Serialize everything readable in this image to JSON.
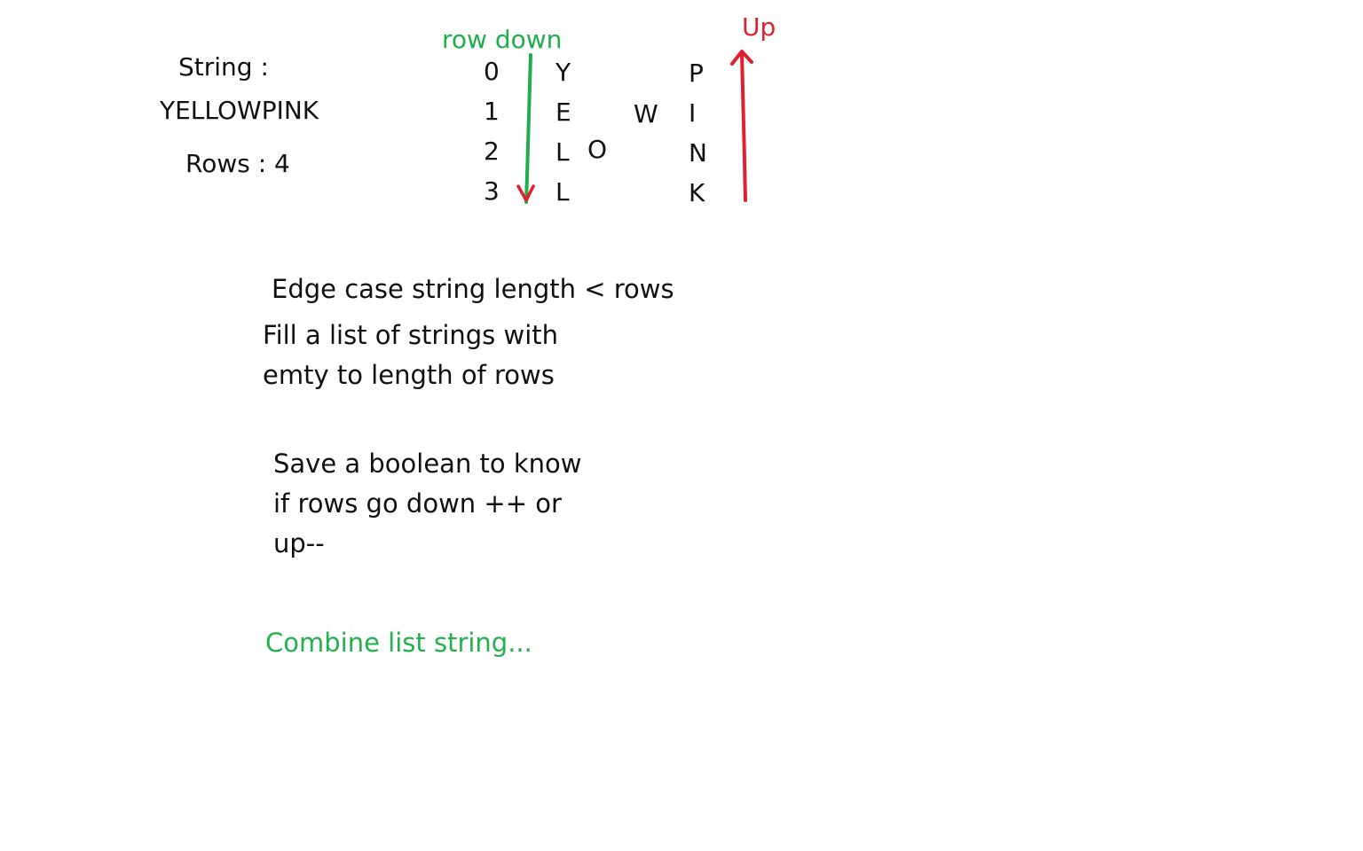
{
  "string_label": "String :",
  "string_value": "YELLOWPINK",
  "rows_label": "Rows : 4",
  "down_label": "row down",
  "up_label": "Up",
  "row_indices": [
    "0",
    "1",
    "2",
    "3"
  ],
  "zigzag": {
    "col1": [
      "Y",
      "E",
      "L",
      "L"
    ],
    "col2": [
      "O"
    ],
    "col3": [
      "W"
    ],
    "col4": [
      "P",
      "I",
      "N",
      "K"
    ]
  },
  "notes": {
    "edge_case": "Edge case string length < rows",
    "fill_line1": "Fill a list of strings with",
    "fill_line2": "emty to length of rows",
    "bool_line1": "Save a boolean to know",
    "bool_line2": "if rows go down ++ or",
    "bool_line3": "up--",
    "combine": "Combine list string..."
  },
  "colors": {
    "down_arrow": "#1fae4b",
    "up_arrow": "#e0202e",
    "combine_text": "#22b14c",
    "text": "#111111"
  }
}
